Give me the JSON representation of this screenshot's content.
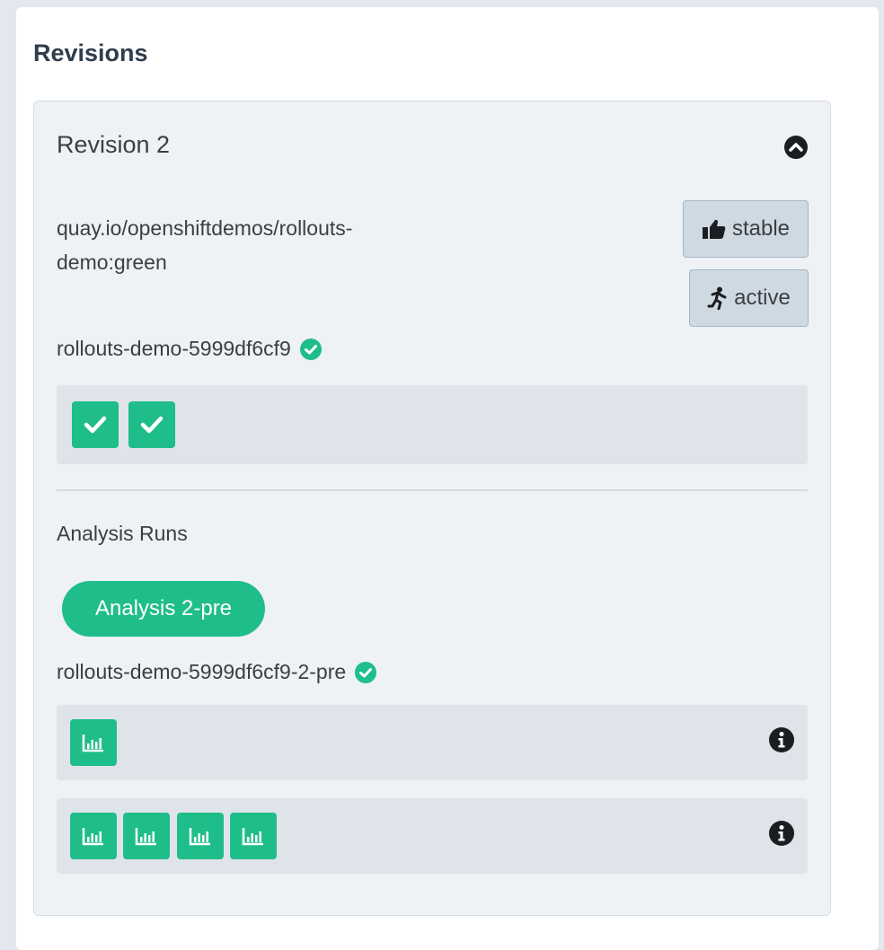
{
  "section": {
    "title": "Revisions"
  },
  "revision": {
    "title": "Revision 2",
    "image_line1": "quay.io/openshiftdemos/rollouts-",
    "image_line2": "demo:green",
    "badges": {
      "stable": "stable",
      "active": "active"
    },
    "replicaset": "rollouts-demo-5999df6cf9",
    "pods": [
      "check-icon",
      "check-icon"
    ],
    "analysis": {
      "title": "Analysis Runs",
      "pill_label": "Analysis 2-pre",
      "run_name": "rollouts-demo-5999df6cf9-2-pre",
      "metric_rows": [
        {
          "count": 1,
          "icon": "chart-icon",
          "info_icon": "info-icon"
        },
        {
          "count": 4,
          "icon": "chart-icon",
          "info_icon": "info-icon"
        }
      ]
    }
  },
  "colors": {
    "accent_green": "#1fbd8a",
    "page_bg": "#e3e8ee",
    "card_bg": "#eef2f5",
    "box_bg": "#dee4ea",
    "badge_bg": "#cfd9e2"
  }
}
